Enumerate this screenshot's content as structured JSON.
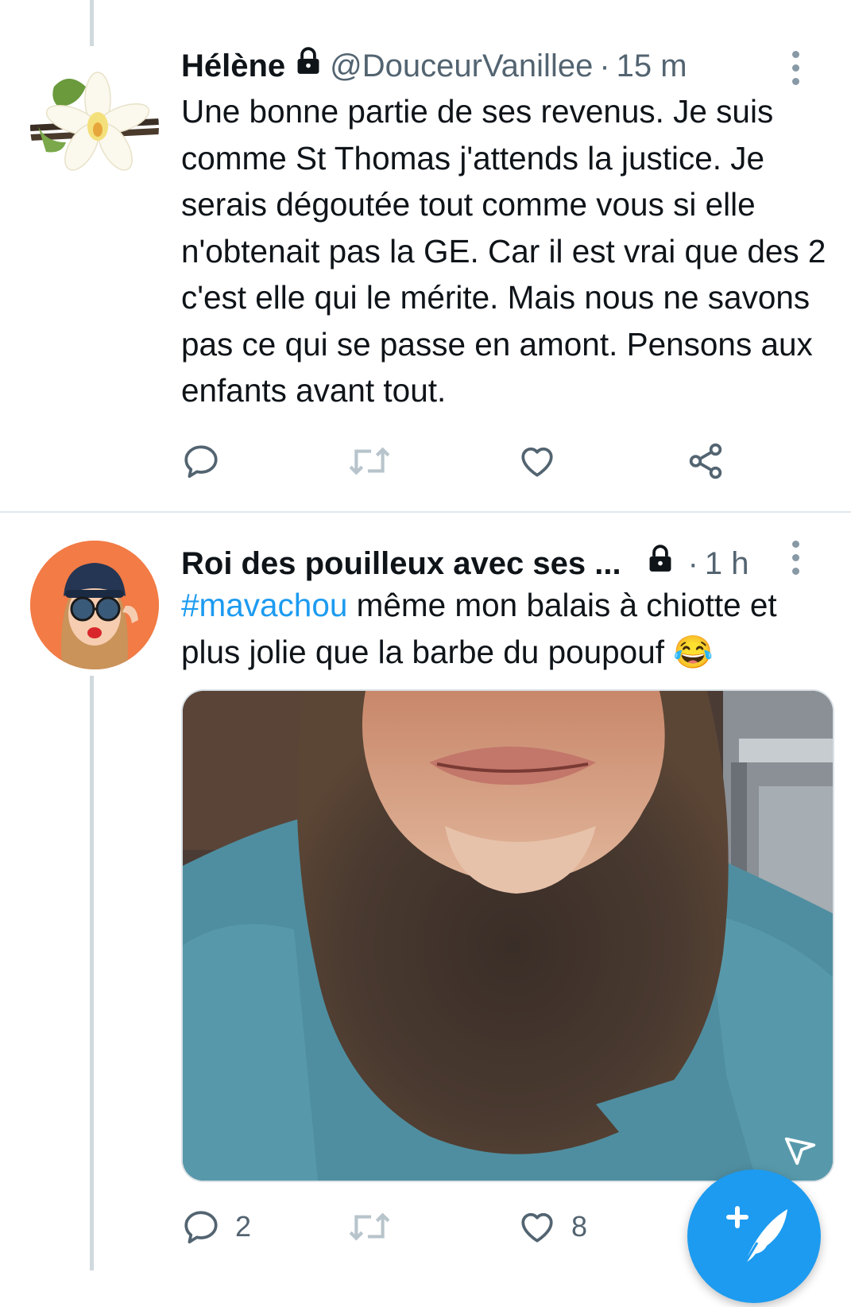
{
  "tweets": [
    {
      "name": "Hélène",
      "handle": "@DouceurVanillee",
      "separator": "·",
      "time": "15 m",
      "text": "Une bonne partie de ses revenus. Je suis comme St Thomas j'attends la justice. Je serais dégoutée tout comme vous si elle n'obtenait pas la GE. Car il est vrai que des 2 c'est elle qui le mérite. Mais nous ne savons pas ce qui se passe en amont. Pensons aux enfants avant tout."
    },
    {
      "name": "Roi des pouilleux avec ses ...",
      "separator": "·",
      "time": "1 h",
      "hashtag": "#mavachou",
      "text": " même mon balais à chiotte et plus jolie que la barbe du poupouf 😂",
      "reply_count": "2",
      "like_count": "8"
    }
  ],
  "icons": {
    "lock": "lock-icon",
    "more": "more-vertical-icon",
    "reply": "reply-icon",
    "retweet": "retweet-icon",
    "like": "heart-icon",
    "share": "share-icon",
    "compose": "compose-tweet-icon",
    "video": "video-indicator-icon"
  },
  "colors": {
    "accent": "#1d9bf0",
    "text": "#0f1419",
    "secondary": "#536471"
  }
}
